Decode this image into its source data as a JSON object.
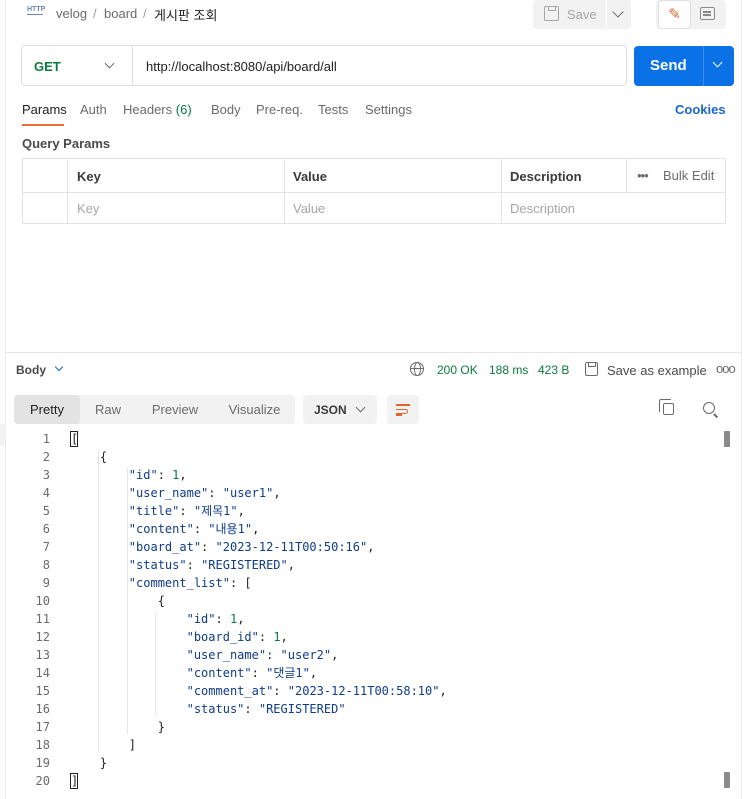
{
  "header": {
    "icon_text": "HTTP",
    "breadcrumb": [
      "velog",
      "board"
    ],
    "separator": "/",
    "current": "게시판 조회",
    "save_label": "Save"
  },
  "request": {
    "method": "GET",
    "url": "http://localhost:8080/api/board/all",
    "send_label": "Send"
  },
  "tabs": [
    {
      "label": "Params"
    },
    {
      "label": "Auth"
    },
    {
      "label": "Headers",
      "count": "(6)"
    },
    {
      "label": "Body"
    },
    {
      "label": "Pre-req."
    },
    {
      "label": "Tests"
    },
    {
      "label": "Settings"
    }
  ],
  "cookies_label": "Cookies",
  "query_params": {
    "title": "Query Params",
    "headers": [
      "Key",
      "Value",
      "Description"
    ],
    "bulk_edit": "Bulk Edit",
    "more": "•••",
    "placeholders": [
      "Key",
      "Value",
      "Description"
    ]
  },
  "response": {
    "label": "Body",
    "status": "200 OK",
    "time": "188 ms",
    "size": "423 B",
    "save_example": "Save as example",
    "more": "ooo",
    "view_tabs": [
      "Pretty",
      "Raw",
      "Preview",
      "Visualize"
    ],
    "format": "JSON"
  },
  "code_lines": [
    "[",
    "    {",
    "        \"id\": 1,",
    "        \"user_name\": \"user1\",",
    "        \"title\": \"제목1\",",
    "        \"content\": \"내용1\",",
    "        \"board_at\": \"2023-12-11T00:50:16\",",
    "        \"status\": \"REGISTERED\",",
    "        \"comment_list\": [",
    "            {",
    "                \"id\": 1,",
    "                \"board_id\": 1,",
    "                \"user_name\": \"user2\",",
    "                \"content\": \"댓글1\",",
    "                \"comment_at\": \"2023-12-11T00:58:10\",",
    "                \"status\": \"REGISTERED\"",
    "            }",
    "        ]",
    "    }",
    "]"
  ],
  "colors": {
    "accent": "#f26b3a",
    "send": "#0a72e6",
    "method": "#0b7a3e",
    "status": "#0b7a3e",
    "json_key": "#0f3c8a"
  }
}
